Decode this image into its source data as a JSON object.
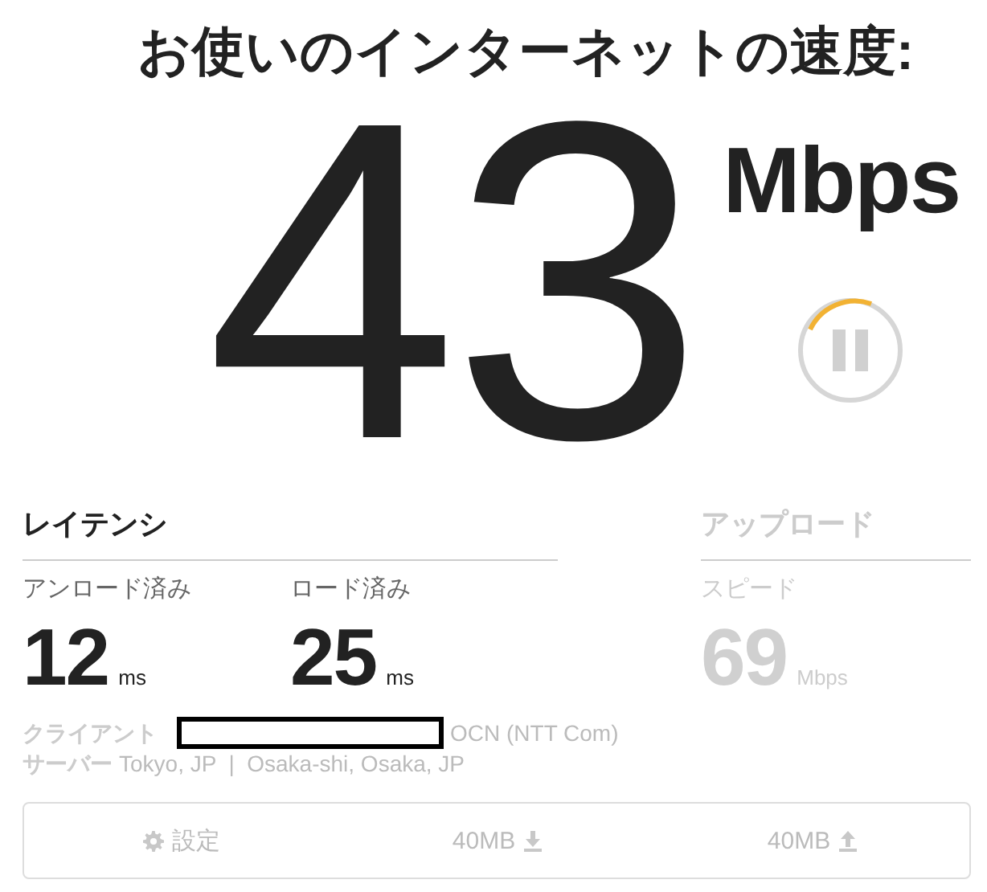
{
  "title": "お使いのインターネットの速度:",
  "speed": {
    "value": "43",
    "unit": "Mbps"
  },
  "latency": {
    "heading": "レイテンシ",
    "active": true,
    "metrics": [
      {
        "label": "アンロード済み",
        "value": "12",
        "unit": "ms"
      },
      {
        "label": "ロード済み",
        "value": "25",
        "unit": "ms"
      }
    ]
  },
  "upload": {
    "heading": "アップロード",
    "active": false,
    "metrics": [
      {
        "label": "スピード",
        "value": "69",
        "unit": "Mbps"
      }
    ]
  },
  "client": {
    "label": "クライアント",
    "isp": "OCN (NTT Com)"
  },
  "server": {
    "label": "サーバー",
    "locations": "Tokyo, JP  |  Osaka-shi, Osaka, JP"
  },
  "settings_bar": {
    "items": [
      {
        "kind": "settings",
        "label": "設定"
      },
      {
        "kind": "download",
        "label": "40MB"
      },
      {
        "kind": "upload",
        "label": "40MB"
      }
    ]
  }
}
